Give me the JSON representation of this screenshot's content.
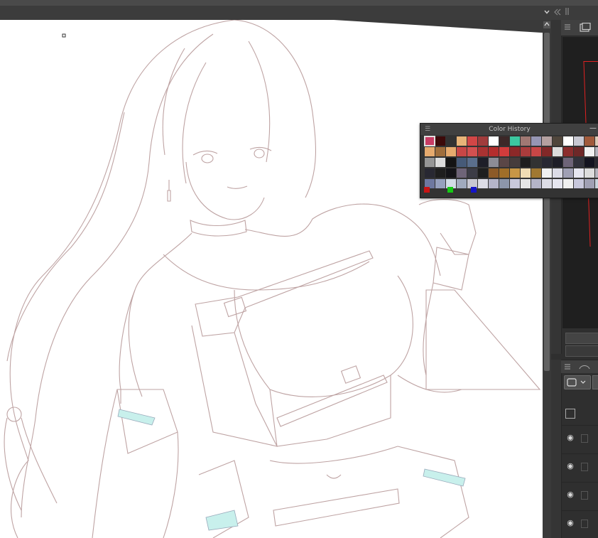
{
  "toolbar": {
    "dropdown_icon": "chevron-down-icon",
    "collapse_icon": "double-chevron-left-icon",
    "grip_icon": "grip-icon"
  },
  "canvas": {
    "description_content": "line-art illustration"
  },
  "color_history": {
    "title": "Color History",
    "minimize_label": "—",
    "menu_icon": "menu-icon",
    "swatches": [
      [
        "#c83c64",
        "#3c0a0a",
        "#323232",
        "#e8b478",
        "#d24646",
        "#a03c3c",
        "#ffffff",
        "#3c2828",
        "#3cc8a0",
        "#a07873",
        "#9696b4",
        "#b4a0a0",
        "#50463c",
        "#ffffff",
        "#c8c8d2",
        "#a05a3c",
        "#dcc8b4"
      ],
      [
        "#e6aa6e",
        "#a06e3c",
        "#e6aa6e",
        "#c84646",
        "#d25050",
        "#aa3232",
        "#b42d2d",
        "#d23c3c",
        "#8c2828",
        "#aa3c3c",
        "#c84646",
        "#822828",
        "#dcdcdc",
        "#8c2d2d",
        "#6e2828",
        "#f0f0f0",
        "#b4b4be"
      ],
      [
        "#969696",
        "#dcdcdc",
        "#141414",
        "#465a78",
        "#5a6e8c",
        "#1e1e28",
        "#8c8c96",
        "#5a4646",
        "#463c3c",
        "#1e1e1e",
        "#323232",
        "#282832",
        "#1e1e28",
        "#6e6478",
        "#32323c",
        "#141420",
        "#282830"
      ],
      [
        "#282832",
        "#1e1e1e",
        "#141418",
        "#6e6478",
        "#3c3c46",
        "#1e1e1e",
        "#8c5a28",
        "#a06e28",
        "#c89646",
        "#f0dcb4",
        "#a07832",
        "#f0f0f0",
        "#dcdce6",
        "#a0a0b4",
        "#e6e6f0",
        "#dcdcdc",
        "#b4b4be"
      ],
      [
        "#6e78a0",
        "#96a0be",
        "#d2dce6",
        "#a0aabe",
        "#c8c8d2",
        "#dcdce6",
        "#b4b4c8",
        "#8c96aa",
        "#c8c8dc",
        "#e6e6e6",
        "#b4b4c8",
        "#dcdce6",
        "#e6e6f0",
        "#f0f0f0",
        "#c8c8dc",
        "#a0a0b4",
        "#c8d2dc"
      ]
    ],
    "current_colors": [
      "#c81414",
      "#14c814",
      "#1414c8"
    ]
  },
  "navigator": {
    "menu_icon": "menu-icon",
    "view_icon": "navigator-icon"
  },
  "layers": {
    "menu_icon": "menu-icon",
    "visibility_icon": "eye-icon",
    "rows": [
      {
        "visible": true
      },
      {
        "visible": true
      },
      {
        "visible": true
      },
      {
        "visible": true
      }
    ]
  }
}
